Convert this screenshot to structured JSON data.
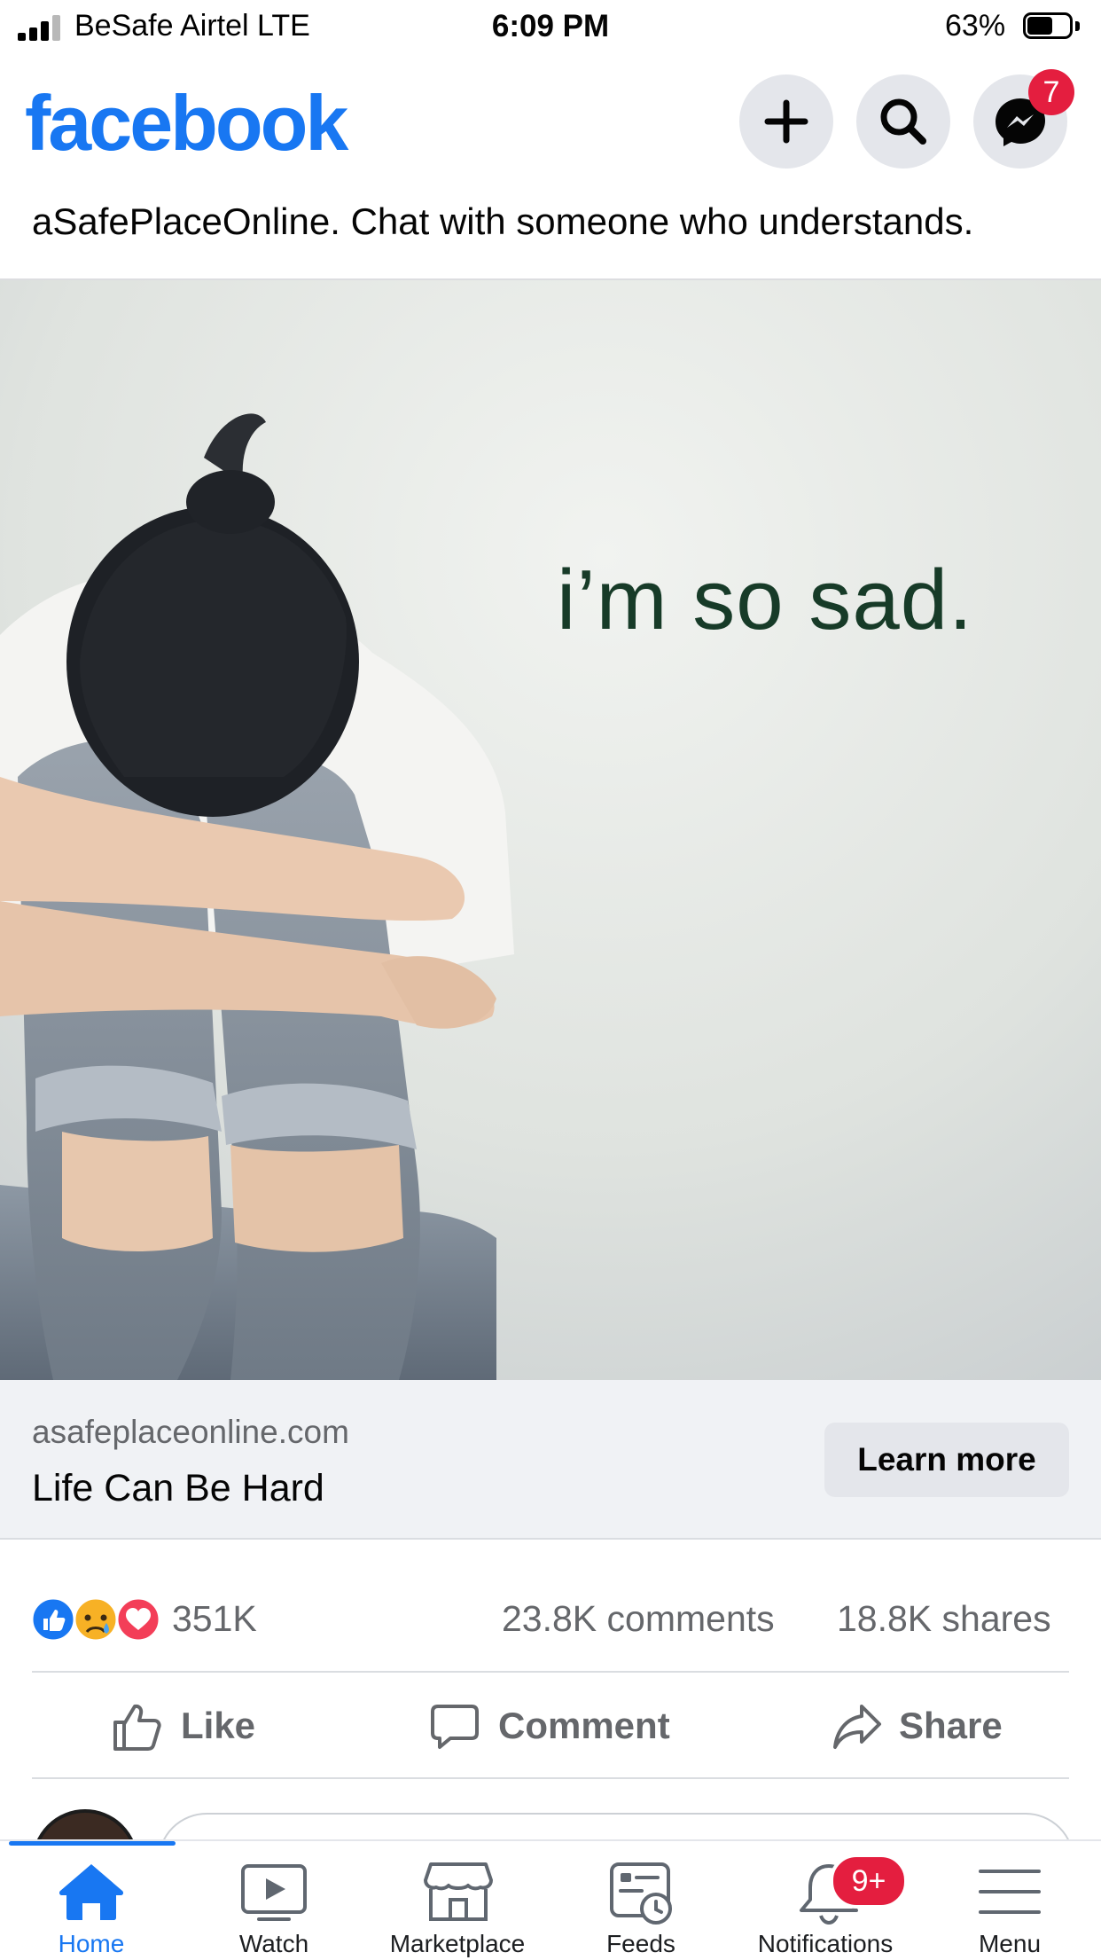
{
  "status_bar": {
    "carrier": "BeSafe Airtel  LTE",
    "time": "6:09 PM",
    "battery_percent": "63%",
    "battery_level": 0.63,
    "signal_bars_filled": 3,
    "signal_bars_total": 4
  },
  "header": {
    "logo": "facebook",
    "buttons": [
      {
        "name": "create-button",
        "icon": "plus-icon"
      },
      {
        "name": "search-button",
        "icon": "search-icon"
      },
      {
        "name": "messenger-button",
        "icon": "messenger-icon",
        "badge": "7"
      }
    ]
  },
  "post": {
    "text_visible": "aSafePlaceOnline. Chat with someone who understands.",
    "image": {
      "caption_text": "i’m so sad.",
      "depicts": "woman-hugging-knees"
    },
    "link": {
      "domain": "asafeplaceonline.com",
      "title": "Life Can Be Hard",
      "cta": "Learn more"
    },
    "reactions": {
      "icons": [
        "like-reaction-icon",
        "sad-reaction-icon",
        "love-reaction-icon"
      ],
      "count": "351K",
      "comments": "23.8K comments",
      "shares": "18.8K shares"
    },
    "actions": [
      {
        "label": "Like",
        "icon": "thumbs-up-icon"
      },
      {
        "label": "Comment",
        "icon": "comment-icon"
      },
      {
        "label": "Share",
        "icon": "share-arrow-icon"
      }
    ]
  },
  "tabbar": {
    "items": [
      {
        "label": "Home",
        "icon": "home-icon",
        "active": true
      },
      {
        "label": "Watch",
        "icon": "watch-icon"
      },
      {
        "label": "Marketplace",
        "icon": "marketplace-icon"
      },
      {
        "label": "Feeds",
        "icon": "feeds-icon"
      },
      {
        "label": "Notifications",
        "icon": "bell-icon",
        "badge": "9+"
      },
      {
        "label": "Menu",
        "icon": "menu-icon"
      }
    ]
  },
  "colors": {
    "brand": "#1877f2",
    "badge": "#e41e3f",
    "secondary_text": "#65676b",
    "caption_text": "#173b28"
  }
}
